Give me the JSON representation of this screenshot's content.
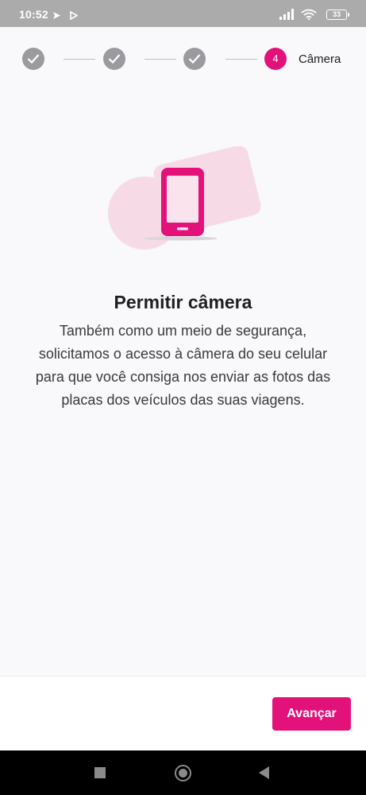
{
  "status_bar": {
    "time": "10:52",
    "battery": "33",
    "icons": [
      "send-icon",
      "play-icon",
      "signal-icon",
      "wifi-icon",
      "battery-icon"
    ]
  },
  "stepper": {
    "steps": [
      {
        "state": "done",
        "icon": "check-icon"
      },
      {
        "state": "done",
        "icon": "check-icon"
      },
      {
        "state": "done",
        "icon": "check-icon"
      },
      {
        "state": "current",
        "number": "4",
        "label": "Câmera"
      }
    ]
  },
  "content": {
    "illustration": "phone-icon",
    "title": "Permitir câmera",
    "description": "Também como um meio de segurança, solicitamos o acesso à câmera do seu celular para que você consiga nos enviar as fotos das placas dos veículos das suas viagens."
  },
  "actions": {
    "next_label": "Avançar"
  },
  "colors": {
    "accent": "#e2127a",
    "step_done": "#9b9b9f",
    "background": "#f9f8fa"
  },
  "nav_bar": {
    "icons": [
      "recents-icon",
      "home-icon",
      "back-icon"
    ]
  }
}
